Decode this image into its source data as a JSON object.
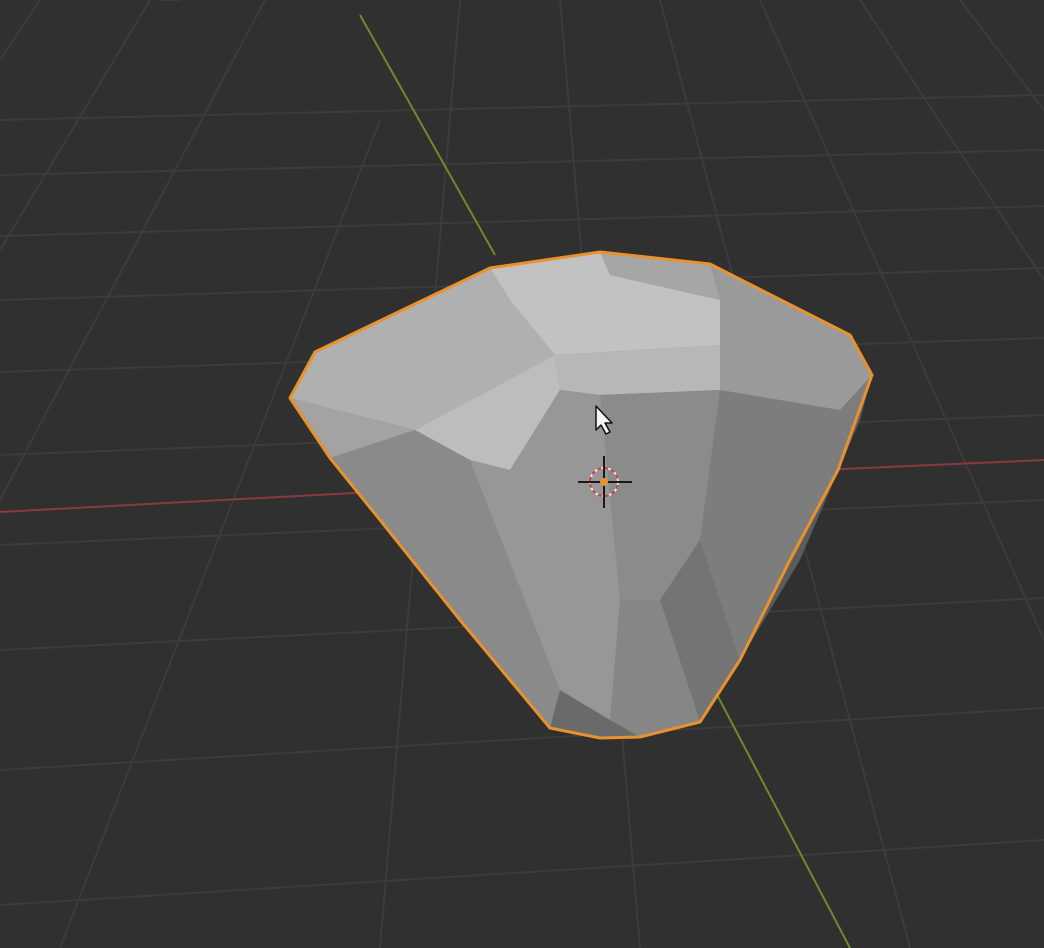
{
  "viewport": {
    "background": "#303030",
    "grid_color": "#3b3b3b",
    "x_axis_color": "#8a3a3e",
    "y_axis_color": "#6d8a2c"
  },
  "object": {
    "type": "mesh",
    "shape": "gem",
    "selected": true,
    "outline_color": "#e8922e",
    "face_colors": {
      "light": "#b9b9b9",
      "mid": "#9a9a9a",
      "dark": "#7c7c7c",
      "shadow": "#5a5a5a"
    }
  },
  "icons": {
    "origin": "object-origin-icon",
    "cursor": "mouse-cursor-icon"
  }
}
